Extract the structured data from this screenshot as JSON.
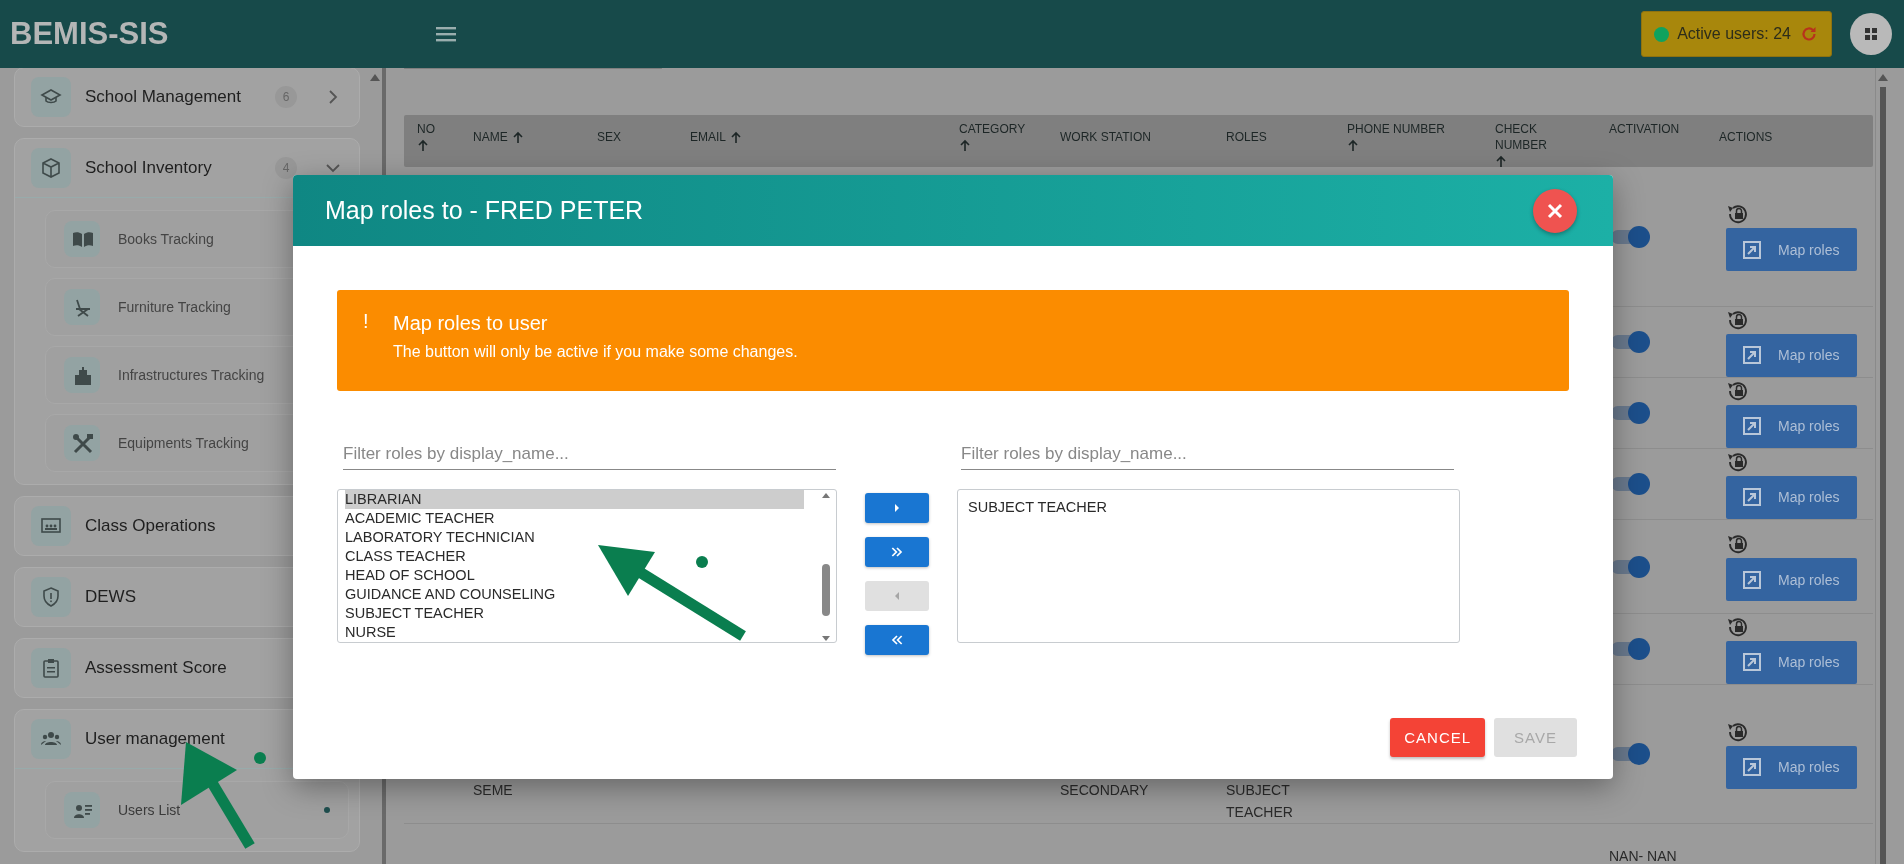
{
  "header": {
    "logo": "BEMIS-SIS",
    "active_users": "Active users: 24"
  },
  "sidebar": {
    "items": [
      {
        "label": "School Management",
        "badge": "6",
        "expanded": false
      },
      {
        "label": "School Inventory",
        "badge": "4",
        "expanded": true,
        "children": [
          {
            "label": "Books Tracking",
            "selected": false
          },
          {
            "label": "Furniture Tracking",
            "selected": false
          },
          {
            "label": "Infrastructures Tracking",
            "selected": false
          },
          {
            "label": "Equipments Tracking",
            "selected": false
          }
        ]
      },
      {
        "label": "Class Operations",
        "expanded": false
      },
      {
        "label": "DEWS",
        "expanded": false
      },
      {
        "label": "Assessment Score",
        "expanded": false
      },
      {
        "label": "User management",
        "expanded": true,
        "children": [
          {
            "label": "Users List",
            "selected": true
          }
        ]
      }
    ]
  },
  "table": {
    "columns": [
      {
        "label": "NO",
        "sortable": true
      },
      {
        "label": "NAME",
        "sortable": true
      },
      {
        "label": "SEX",
        "sortable": false
      },
      {
        "label": "EMAIL",
        "sortable": true
      },
      {
        "label": "CATEGORY",
        "sortable": true
      },
      {
        "label": "WORK STATION",
        "sortable": false
      },
      {
        "label": "ROLES",
        "sortable": false
      },
      {
        "label": "PHONE NUMBER",
        "sortable": true
      },
      {
        "label": "CHECK NUMBER",
        "sortable": true
      },
      {
        "label": "ACTIVATION",
        "sortable": false
      },
      {
        "label": "ACTIONS",
        "sortable": false
      }
    ],
    "rows": [
      {
        "active": true,
        "action": "Map roles"
      },
      {
        "active": true,
        "action": "Map roles"
      },
      {
        "active": true,
        "action": "Map roles"
      },
      {
        "active": true,
        "action": "Map roles"
      },
      {
        "active": true,
        "action": "Map roles"
      },
      {
        "active": true,
        "action": "Map roles"
      },
      {
        "name": "SEME",
        "work_station": "SECONDARY",
        "roles": "SUBJECT TEACHER",
        "active": true,
        "action": "Map roles"
      },
      {
        "activation_text": "NAN- NAN"
      }
    ]
  },
  "modal": {
    "title": "Map roles to - FRED PETER",
    "alert": {
      "icon": "!",
      "title": "Map roles to user",
      "message": "The button will only be active if you make some changes."
    },
    "available": {
      "placeholder": "Filter roles by display_name...",
      "items": [
        {
          "label": "LIBRARIAN",
          "selected": true
        },
        {
          "label": "ACADEMIC TEACHER",
          "selected": false
        },
        {
          "label": "LABORATORY TECHNICIAN",
          "selected": false
        },
        {
          "label": "CLASS TEACHER",
          "selected": false
        },
        {
          "label": "HEAD OF SCHOOL",
          "selected": false
        },
        {
          "label": "GUIDANCE AND COUNSELING",
          "selected": false
        },
        {
          "label": "SUBJECT TEACHER",
          "selected": false
        },
        {
          "label": "NURSE",
          "selected": false
        }
      ]
    },
    "assigned": {
      "placeholder": "Filter roles by display_name...",
      "items": [
        {
          "label": "SUBJECT TEACHER",
          "selected": false
        }
      ]
    },
    "transfer_buttons": [
      {
        "kind": "move-one",
        "disabled": false
      },
      {
        "kind": "move-all",
        "disabled": false
      },
      {
        "kind": "remove-one",
        "disabled": true
      },
      {
        "kind": "remove-all",
        "disabled": false
      }
    ],
    "buttons": [
      {
        "label": "CANCEL",
        "kind": "cancel",
        "disabled": false
      },
      {
        "label": "SAVE",
        "kind": "save",
        "disabled": true
      }
    ]
  }
}
